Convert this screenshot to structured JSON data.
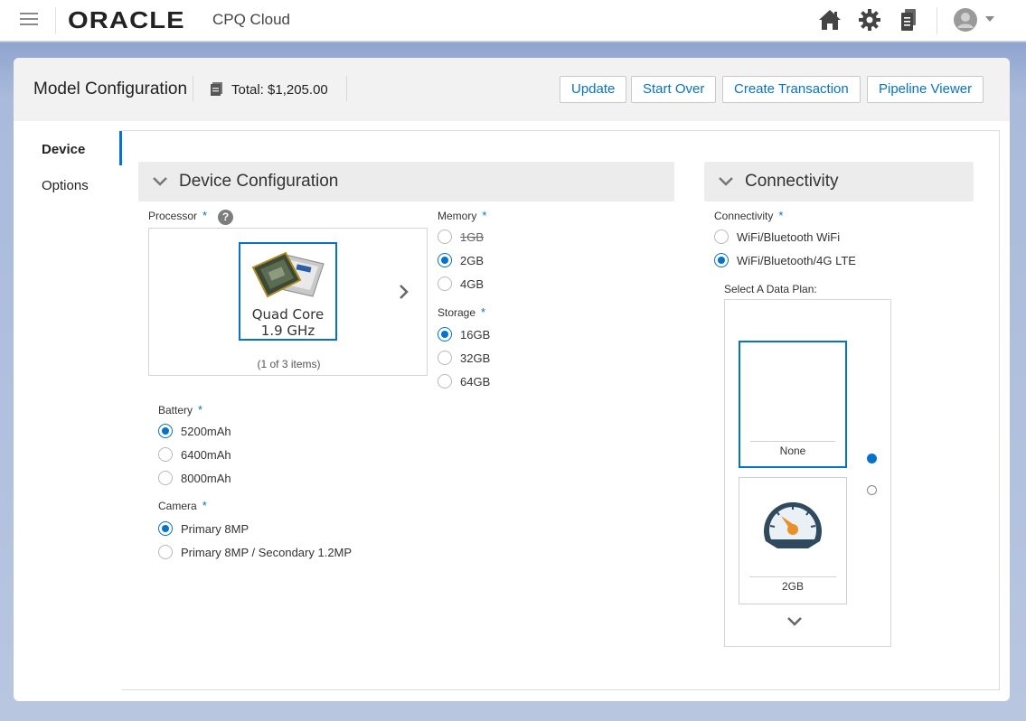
{
  "header": {
    "brand": "ORACLE",
    "app_name": "CPQ Cloud",
    "icons": [
      "menu-icon",
      "home-icon",
      "gear-icon",
      "documents-icon",
      "user-avatar-icon"
    ]
  },
  "toolbar": {
    "title": "Model Configuration",
    "total": "Total: $1,205.00",
    "buttons": {
      "update": "Update",
      "start_over": "Start Over",
      "create_transaction": "Create Transaction",
      "pipeline_viewer": "Pipeline Viewer"
    }
  },
  "nav": {
    "items": [
      {
        "label": "Device",
        "active": true
      },
      {
        "label": "Options",
        "active": false
      }
    ]
  },
  "device_configuration": {
    "title": "Device Configuration",
    "processor": {
      "label": "Processor",
      "help": "?",
      "selected_line1": "Quad Core",
      "selected_line2": "1.9 GHz",
      "count": "(1 of 3 items)"
    },
    "memory": {
      "label": "Memory",
      "options": [
        {
          "label": "1GB",
          "selected": false,
          "disabled": true
        },
        {
          "label": "2GB",
          "selected": true,
          "disabled": false
        },
        {
          "label": "4GB",
          "selected": false,
          "disabled": false
        }
      ]
    },
    "storage": {
      "label": "Storage",
      "options": [
        {
          "label": "16GB",
          "selected": true
        },
        {
          "label": "32GB",
          "selected": false
        },
        {
          "label": "64GB",
          "selected": false
        }
      ]
    },
    "battery": {
      "label": "Battery",
      "options": [
        {
          "label": "5200mAh",
          "selected": true
        },
        {
          "label": "6400mAh",
          "selected": false
        },
        {
          "label": "8000mAh",
          "selected": false
        }
      ]
    },
    "camera": {
      "label": "Camera",
      "options": [
        {
          "label": "Primary 8MP",
          "selected": true
        },
        {
          "label": "Primary 8MP / Secondary 1.2MP",
          "selected": false
        }
      ]
    }
  },
  "connectivity": {
    "title": "Connectivity",
    "label": "Connectivity",
    "options": [
      {
        "label": "WiFi/Bluetooth WiFi",
        "selected": false
      },
      {
        "label": "WiFi/Bluetooth/4G LTE",
        "selected": true
      }
    ],
    "data_plan": {
      "label": "Select A Data Plan:",
      "plans": [
        {
          "name": "None",
          "selected": true
        },
        {
          "name": "2GB",
          "selected": false
        }
      ]
    }
  },
  "required_marker": "*",
  "colors": {
    "accent": "#0572ce",
    "background": "#b4c3de",
    "section_header": "#ececec"
  }
}
